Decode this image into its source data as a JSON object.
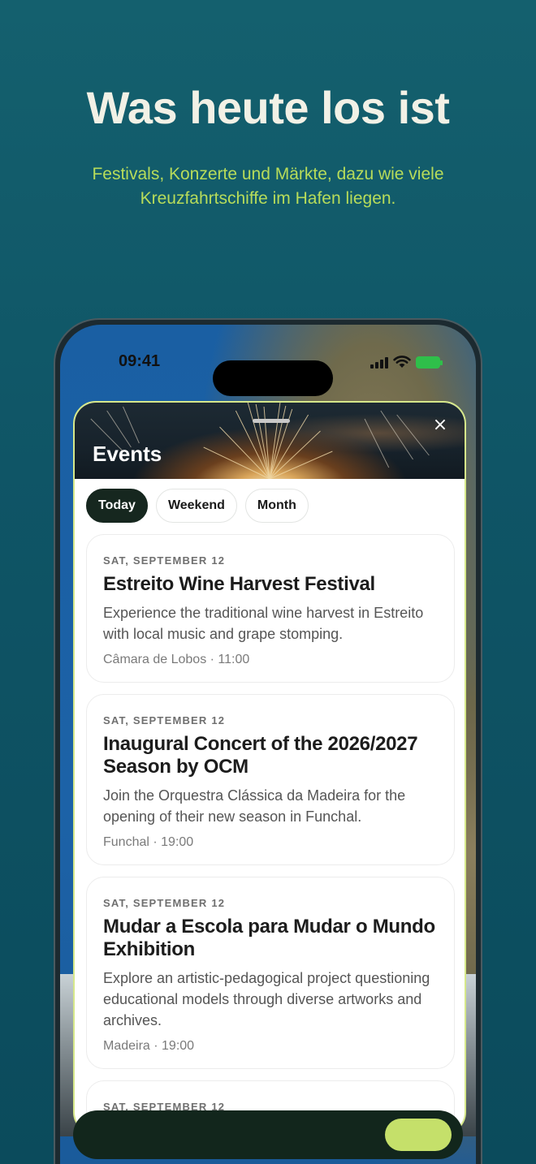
{
  "hero": {
    "title": "Was heute los ist",
    "subtitle": "Festivals, Konzerte und Märkte, dazu wie viele Kreuzfahrtschiffe im Hafen liegen."
  },
  "status_bar": {
    "time": "09:41",
    "icons": [
      "signal-icon",
      "wifi-icon",
      "battery-icon"
    ]
  },
  "sheet": {
    "title": "Events",
    "close_label": "×",
    "tabs": [
      {
        "label": "Today",
        "active": true
      },
      {
        "label": "Weekend",
        "active": false
      },
      {
        "label": "Month",
        "active": false
      }
    ]
  },
  "events": [
    {
      "date": "SAT, SEPTEMBER 12",
      "title": "Estreito Wine Harvest Festival",
      "description": "Experience the traditional wine harvest in Estreito with local music and grape stomping.",
      "meta": "Câmara de Lobos · 11:00"
    },
    {
      "date": "SAT, SEPTEMBER 12",
      "title": "Inaugural Concert of the 2026/2027 Season by OCM",
      "description": "Join the Orquestra Clássica da Madeira for the opening of their new season in Funchal.",
      "meta": "Funchal · 19:00"
    },
    {
      "date": "SAT, SEPTEMBER 12",
      "title": "Mudar a Escola para Mudar o Mundo Exhibition",
      "description": "Explore an artistic-pedagogical project questioning educational models through diverse artworks and archives.",
      "meta": "Madeira · 19:00"
    },
    {
      "date": "SAT, SEPTEMBER 12",
      "title": "",
      "description": "",
      "meta": ""
    }
  ],
  "colors": {
    "background": "#0f5566",
    "hero_title": "#f2f1e6",
    "hero_subtitle": "#b7dc5a",
    "active_tab": "#16271f",
    "accent_pill": "#c5e06a"
  }
}
